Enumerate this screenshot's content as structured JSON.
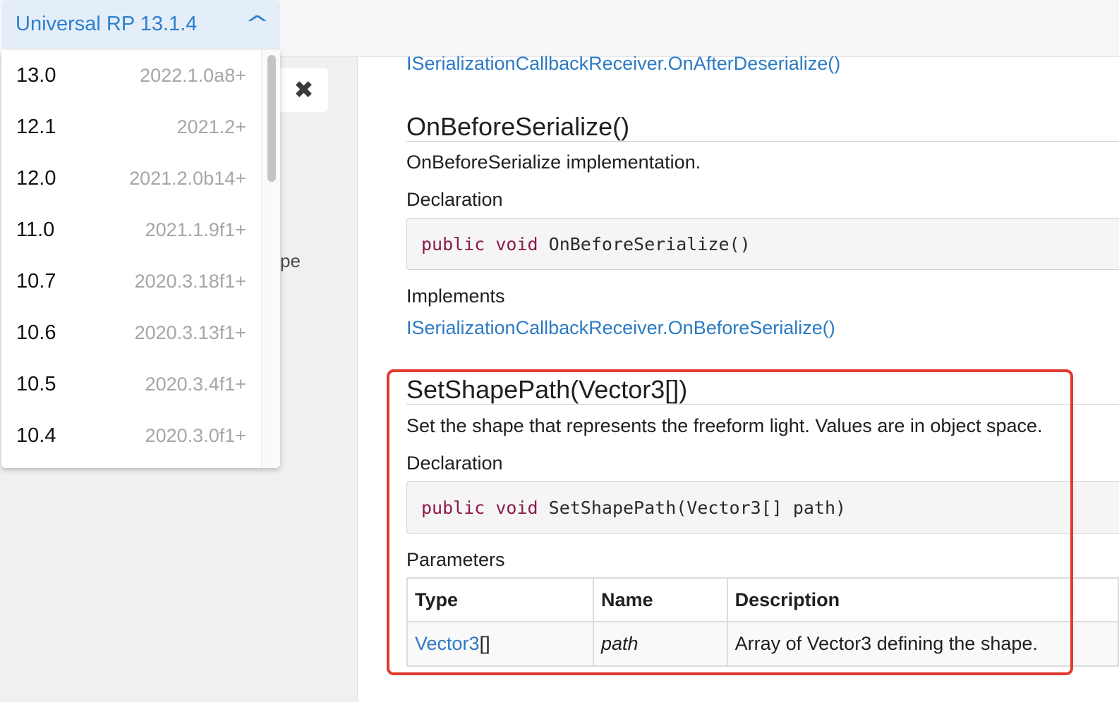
{
  "version_selector": {
    "label": "Universal RP 13.1.4",
    "options": [
      {
        "version": "13.0",
        "unity": "2022.1.0a8+"
      },
      {
        "version": "12.1",
        "unity": "2021.2+"
      },
      {
        "version": "12.0",
        "unity": "2021.2.0b14+"
      },
      {
        "version": "11.0",
        "unity": "2021.1.9f1+"
      },
      {
        "version": "10.7",
        "unity": "2020.3.18f1+"
      },
      {
        "version": "10.6",
        "unity": "2020.3.13f1+"
      },
      {
        "version": "10.5",
        "unity": "2020.3.4f1+"
      },
      {
        "version": "10.4",
        "unity": "2020.3.0f1+"
      }
    ]
  },
  "sidebar": {
    "close_glyph": "✖",
    "partial_text": "pe"
  },
  "content": {
    "prev_link": "ISerializationCallbackReceiver.OnAfterDeserialize()",
    "on_before": {
      "title": "OnBeforeSerialize()",
      "summary": "OnBeforeSerialize implementation.",
      "declaration_label": "Declaration",
      "code_keywords": "public void",
      "code_rest": "OnBeforeSerialize()",
      "implements_label": "Implements",
      "implements_link": "ISerializationCallbackReceiver.OnBeforeSerialize()"
    },
    "set_shape": {
      "title": "SetShapePath(Vector3[])",
      "summary": "Set the shape that represents the freeform light. Values are in object space.",
      "declaration_label": "Declaration",
      "code_keywords": "public void",
      "code_rest": "SetShapePath(Vector3[] path)",
      "parameters_label": "Parameters",
      "table": {
        "headers": [
          "Type",
          "Name",
          "Description"
        ],
        "rows": [
          {
            "type_link": "Vector3",
            "type_suffix": "[]",
            "name": "path",
            "description": "Array of Vector3 defining the shape."
          }
        ]
      }
    }
  },
  "colors": {
    "link": "#2d7ac4",
    "keyword": "#8b1a4a",
    "highlight": "#e33a2f"
  }
}
